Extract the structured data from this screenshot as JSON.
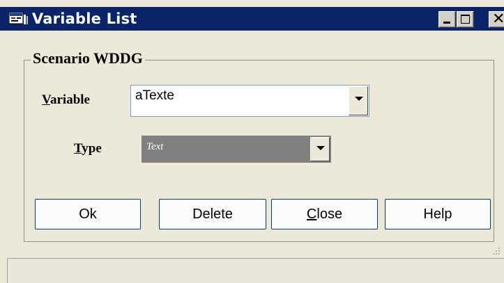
{
  "window": {
    "title": "Variable List",
    "titlebar_color": "#0a246a",
    "icon": "app-window-icon"
  },
  "title_buttons": {
    "minimize": "minimize-icon",
    "maximize": "maximize-icon",
    "close": "close-icon",
    "close_glyph": "✕"
  },
  "group": {
    "title": "Scenario WDDG"
  },
  "fields": {
    "variable": {
      "label_mnemonic": "V",
      "label_rest": "ariable",
      "value": "aTexte"
    },
    "type": {
      "label_mnemonic": "T",
      "label_rest": "ype",
      "value": "Text",
      "disabled": true
    }
  },
  "buttons": {
    "ok": "Ok",
    "delete": "Delete",
    "close_mnemonic": "C",
    "close_rest": "lose",
    "help": "Help"
  },
  "statusbar": {
    "text": ""
  }
}
